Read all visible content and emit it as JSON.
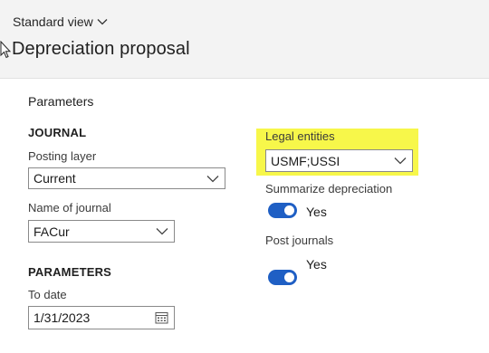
{
  "header": {
    "view_label": "Standard view",
    "view_icon": "chevron-down-icon",
    "title": "Depreciation proposal"
  },
  "dialog": {
    "section_title": "Parameters",
    "journal_group": {
      "heading": "JOURNAL",
      "posting_layer": {
        "label": "Posting layer",
        "value": "Current"
      },
      "journal_name": {
        "label": "Name of journal",
        "value": "FACur"
      }
    },
    "parameters_group": {
      "heading": "PARAMETERS",
      "to_date": {
        "label": "To date",
        "value": "1/31/2023",
        "icon": "calendar-icon"
      }
    },
    "legal_entities": {
      "label": "Legal entities",
      "value": "USMF;USSI"
    },
    "summarize_depreciation": {
      "label": "Summarize depreciation",
      "state": "Yes",
      "on": true
    },
    "post_journals": {
      "label": "Post journals",
      "state": "Yes",
      "on": true
    }
  },
  "colors": {
    "highlight": "#f7f74a",
    "toggle_on": "#1f5fc4",
    "panel_bg": "#ffffff",
    "page_bg": "#f3f3f3"
  }
}
